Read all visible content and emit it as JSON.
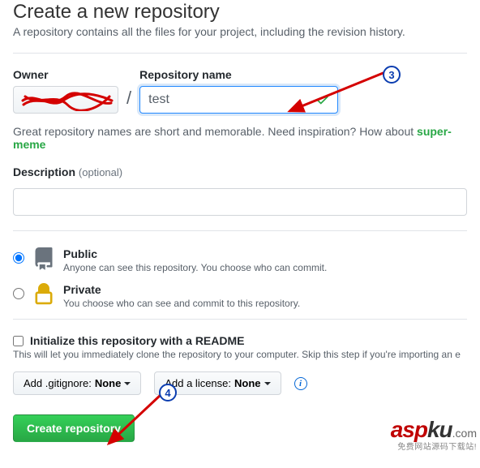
{
  "header": {
    "title": "Create a new repository",
    "subtitle": "A repository contains all the files for your project, including the revision history."
  },
  "owner": {
    "label": "Owner"
  },
  "repo": {
    "label": "Repository name",
    "value": "test"
  },
  "hint": {
    "text_prefix": "Great repository names are short and memorable. Need inspiration? How about ",
    "suggestion": "super-meme"
  },
  "description": {
    "label": "Description",
    "optional": "(optional)",
    "value": ""
  },
  "visibility": {
    "public": {
      "title": "Public",
      "desc": "Anyone can see this repository. You choose who can commit."
    },
    "private": {
      "title": "Private",
      "desc": "You choose who can see and commit to this repository."
    }
  },
  "init": {
    "label": "Initialize this repository with a README",
    "desc": "This will let you immediately clone the repository to your computer. Skip this step if you're importing an e"
  },
  "dropdowns": {
    "gitignore_prefix": "Add .gitignore: ",
    "gitignore_value": "None",
    "license_prefix": "Add a license: ",
    "license_value": "None"
  },
  "submit": {
    "label": "Create repository"
  },
  "annotations": {
    "badge3": "3",
    "badge4": "4"
  },
  "watermark": {
    "asp": "asp",
    "ku": "ku",
    "dot": ".com",
    "sub": "免费网站源码下载站!"
  }
}
